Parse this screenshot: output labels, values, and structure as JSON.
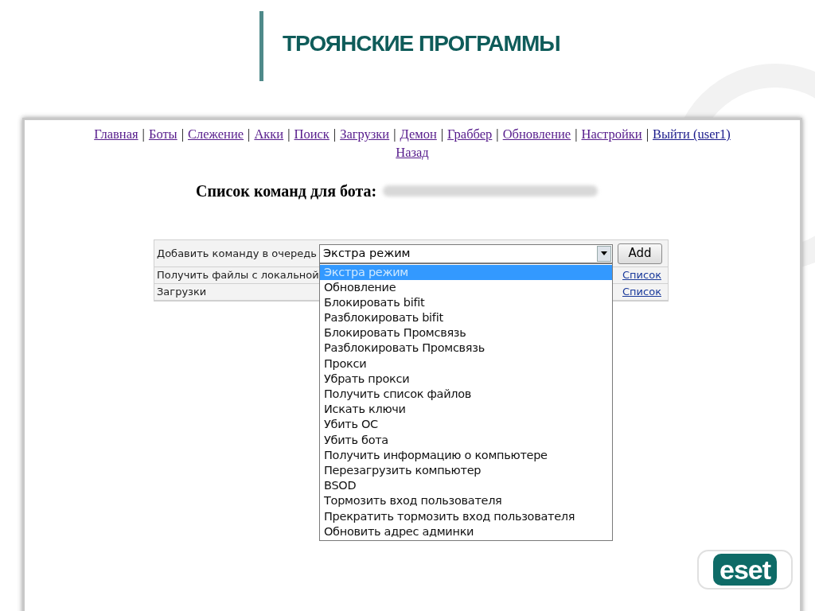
{
  "slide": {
    "title": "ТРОЯНСКИЕ ПРОГРАММЫ",
    "logo": "eset"
  },
  "nav_lines": [
    [
      {
        "kind": "link",
        "label": "Главная",
        "visited": true
      },
      {
        "kind": "separator",
        "label": "|"
      },
      {
        "kind": "link",
        "label": "Боты",
        "visited": true
      },
      {
        "kind": "separator",
        "label": "|"
      },
      {
        "kind": "link",
        "label": "Слежение",
        "visited": true
      },
      {
        "kind": "separator",
        "label": "|"
      },
      {
        "kind": "link",
        "label": "Акки",
        "visited": true
      },
      {
        "kind": "separator",
        "label": "|"
      },
      {
        "kind": "link",
        "label": "Поиск",
        "visited": true
      },
      {
        "kind": "separator",
        "label": "|"
      },
      {
        "kind": "link",
        "label": "Загрузки",
        "visited": true
      },
      {
        "kind": "separator",
        "label": "|"
      },
      {
        "kind": "link",
        "label": "Демон",
        "visited": true
      },
      {
        "kind": "separator",
        "label": "|"
      },
      {
        "kind": "link",
        "label": "Граббер",
        "visited": true
      },
      {
        "kind": "separator",
        "label": "|"
      },
      {
        "kind": "link",
        "label": "Обновление",
        "visited": true
      },
      {
        "kind": "separator",
        "label": "|"
      },
      {
        "kind": "link",
        "label": "Настройки",
        "visited": true
      },
      {
        "kind": "separator",
        "label": "|"
      },
      {
        "kind": "link",
        "label": "Выйти (user1)",
        "visited": false
      }
    ],
    [
      {
        "kind": "link",
        "label": "Назад",
        "visited": true
      }
    ]
  ],
  "heading": "Список команд для бота:",
  "rows": [
    {
      "label": "Добавить команду в очередь",
      "kind": "select",
      "value": "Экстра режим",
      "button": "Add"
    },
    {
      "label": "Получить файлы с локальной",
      "kind": "link",
      "link": "Список"
    },
    {
      "label": "Загрузки",
      "kind": "link",
      "link": "Список"
    }
  ],
  "dropdown": {
    "expanded": true,
    "options": [
      {
        "label": "Экстра режим",
        "selected": true
      },
      {
        "label": "Обновление",
        "selected": false
      },
      {
        "label": "Блокировать bifit",
        "selected": false
      },
      {
        "label": "Разблокировать bifit",
        "selected": false
      },
      {
        "label": "Блокировать Промсвязь",
        "selected": false
      },
      {
        "label": "Разблокировать Промсвязь",
        "selected": false
      },
      {
        "label": "Прокси",
        "selected": false
      },
      {
        "label": "Убрать прокси",
        "selected": false
      },
      {
        "label": "Получить список файлов",
        "selected": false
      },
      {
        "label": "Искать ключи",
        "selected": false
      },
      {
        "label": "Убить ОС",
        "selected": false
      },
      {
        "label": "Убить бота",
        "selected": false
      },
      {
        "label": "Получить информацию о компьютере",
        "selected": false
      },
      {
        "label": "Перезагрузить компьютер",
        "selected": false
      },
      {
        "label": "BSOD",
        "selected": false
      },
      {
        "label": "Тормозить вход пользователя",
        "selected": false
      },
      {
        "label": "Прекратить тормозить вход пользователя",
        "selected": false
      },
      {
        "label": "Обновить адрес админки",
        "selected": false
      }
    ]
  }
}
